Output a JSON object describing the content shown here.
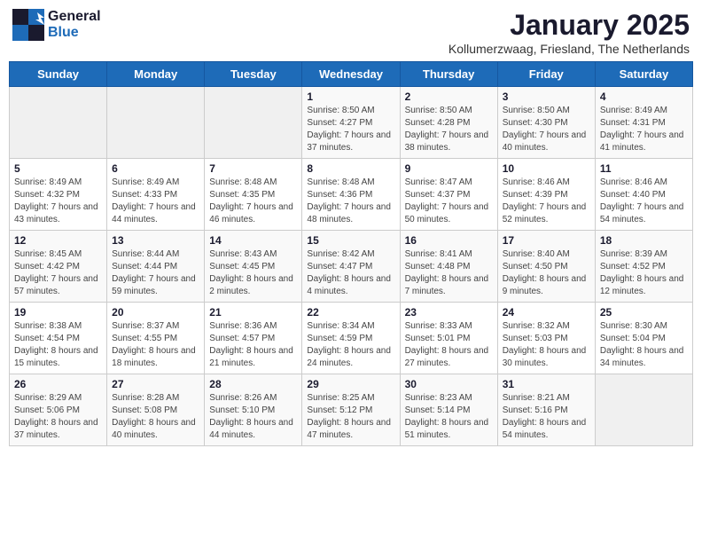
{
  "header": {
    "logo_line1": "General",
    "logo_line2": "Blue",
    "month": "January 2025",
    "location": "Kollumerzwaag, Friesland, The Netherlands"
  },
  "days_of_week": [
    "Sunday",
    "Monday",
    "Tuesday",
    "Wednesday",
    "Thursday",
    "Friday",
    "Saturday"
  ],
  "weeks": [
    [
      {
        "day": "",
        "content": ""
      },
      {
        "day": "",
        "content": ""
      },
      {
        "day": "",
        "content": ""
      },
      {
        "day": "1",
        "content": "Sunrise: 8:50 AM\nSunset: 4:27 PM\nDaylight: 7 hours and 37 minutes."
      },
      {
        "day": "2",
        "content": "Sunrise: 8:50 AM\nSunset: 4:28 PM\nDaylight: 7 hours and 38 minutes."
      },
      {
        "day": "3",
        "content": "Sunrise: 8:50 AM\nSunset: 4:30 PM\nDaylight: 7 hours and 40 minutes."
      },
      {
        "day": "4",
        "content": "Sunrise: 8:49 AM\nSunset: 4:31 PM\nDaylight: 7 hours and 41 minutes."
      }
    ],
    [
      {
        "day": "5",
        "content": "Sunrise: 8:49 AM\nSunset: 4:32 PM\nDaylight: 7 hours and 43 minutes."
      },
      {
        "day": "6",
        "content": "Sunrise: 8:49 AM\nSunset: 4:33 PM\nDaylight: 7 hours and 44 minutes."
      },
      {
        "day": "7",
        "content": "Sunrise: 8:48 AM\nSunset: 4:35 PM\nDaylight: 7 hours and 46 minutes."
      },
      {
        "day": "8",
        "content": "Sunrise: 8:48 AM\nSunset: 4:36 PM\nDaylight: 7 hours and 48 minutes."
      },
      {
        "day": "9",
        "content": "Sunrise: 8:47 AM\nSunset: 4:37 PM\nDaylight: 7 hours and 50 minutes."
      },
      {
        "day": "10",
        "content": "Sunrise: 8:46 AM\nSunset: 4:39 PM\nDaylight: 7 hours and 52 minutes."
      },
      {
        "day": "11",
        "content": "Sunrise: 8:46 AM\nSunset: 4:40 PM\nDaylight: 7 hours and 54 minutes."
      }
    ],
    [
      {
        "day": "12",
        "content": "Sunrise: 8:45 AM\nSunset: 4:42 PM\nDaylight: 7 hours and 57 minutes."
      },
      {
        "day": "13",
        "content": "Sunrise: 8:44 AM\nSunset: 4:44 PM\nDaylight: 7 hours and 59 minutes."
      },
      {
        "day": "14",
        "content": "Sunrise: 8:43 AM\nSunset: 4:45 PM\nDaylight: 8 hours and 2 minutes."
      },
      {
        "day": "15",
        "content": "Sunrise: 8:42 AM\nSunset: 4:47 PM\nDaylight: 8 hours and 4 minutes."
      },
      {
        "day": "16",
        "content": "Sunrise: 8:41 AM\nSunset: 4:48 PM\nDaylight: 8 hours and 7 minutes."
      },
      {
        "day": "17",
        "content": "Sunrise: 8:40 AM\nSunset: 4:50 PM\nDaylight: 8 hours and 9 minutes."
      },
      {
        "day": "18",
        "content": "Sunrise: 8:39 AM\nSunset: 4:52 PM\nDaylight: 8 hours and 12 minutes."
      }
    ],
    [
      {
        "day": "19",
        "content": "Sunrise: 8:38 AM\nSunset: 4:54 PM\nDaylight: 8 hours and 15 minutes."
      },
      {
        "day": "20",
        "content": "Sunrise: 8:37 AM\nSunset: 4:55 PM\nDaylight: 8 hours and 18 minutes."
      },
      {
        "day": "21",
        "content": "Sunrise: 8:36 AM\nSunset: 4:57 PM\nDaylight: 8 hours and 21 minutes."
      },
      {
        "day": "22",
        "content": "Sunrise: 8:34 AM\nSunset: 4:59 PM\nDaylight: 8 hours and 24 minutes."
      },
      {
        "day": "23",
        "content": "Sunrise: 8:33 AM\nSunset: 5:01 PM\nDaylight: 8 hours and 27 minutes."
      },
      {
        "day": "24",
        "content": "Sunrise: 8:32 AM\nSunset: 5:03 PM\nDaylight: 8 hours and 30 minutes."
      },
      {
        "day": "25",
        "content": "Sunrise: 8:30 AM\nSunset: 5:04 PM\nDaylight: 8 hours and 34 minutes."
      }
    ],
    [
      {
        "day": "26",
        "content": "Sunrise: 8:29 AM\nSunset: 5:06 PM\nDaylight: 8 hours and 37 minutes."
      },
      {
        "day": "27",
        "content": "Sunrise: 8:28 AM\nSunset: 5:08 PM\nDaylight: 8 hours and 40 minutes."
      },
      {
        "day": "28",
        "content": "Sunrise: 8:26 AM\nSunset: 5:10 PM\nDaylight: 8 hours and 44 minutes."
      },
      {
        "day": "29",
        "content": "Sunrise: 8:25 AM\nSunset: 5:12 PM\nDaylight: 8 hours and 47 minutes."
      },
      {
        "day": "30",
        "content": "Sunrise: 8:23 AM\nSunset: 5:14 PM\nDaylight: 8 hours and 51 minutes."
      },
      {
        "day": "31",
        "content": "Sunrise: 8:21 AM\nSunset: 5:16 PM\nDaylight: 8 hours and 54 minutes."
      },
      {
        "day": "",
        "content": ""
      }
    ]
  ]
}
